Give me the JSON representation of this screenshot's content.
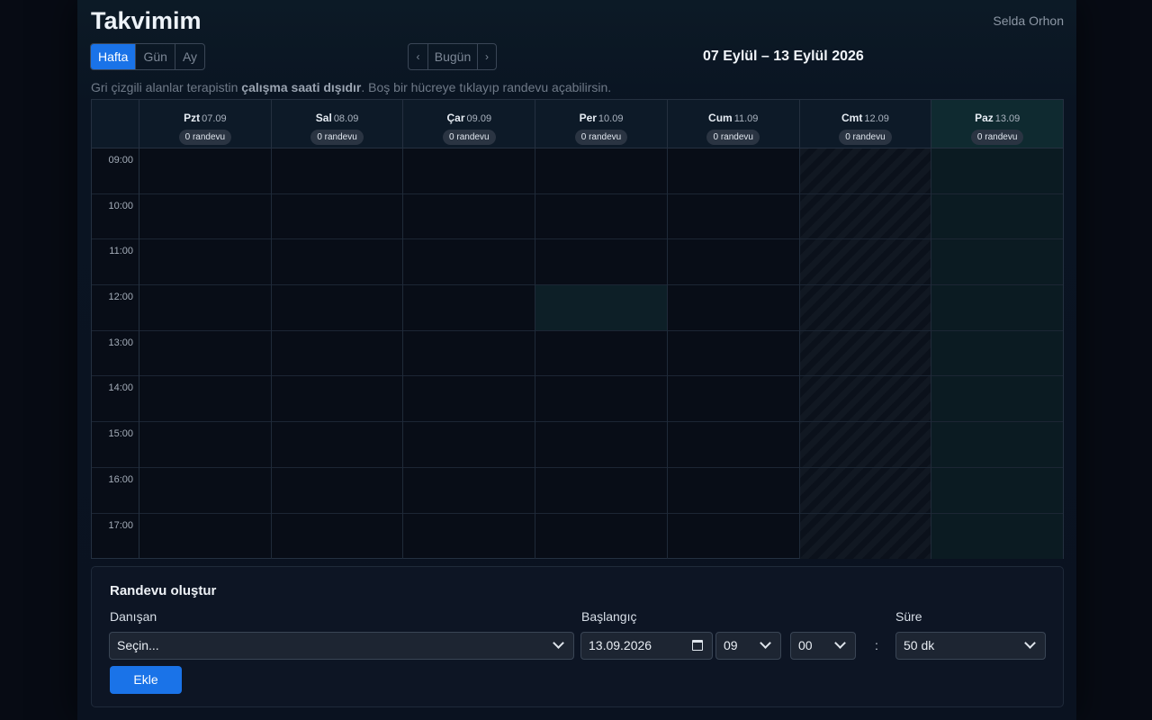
{
  "header": {
    "title": "Takvimim",
    "user_name": "Selda Orhon",
    "views": [
      "Hafta",
      "Gün",
      "Ay"
    ],
    "active_view": "Hafta",
    "nav": {
      "prev": "‹",
      "today": "Bugün",
      "next": "›"
    },
    "range_label": "07 Eylül – 13 Eylül 2026"
  },
  "hint": {
    "before": "Gri çizgili alanlar terapistin ",
    "bold": "çalışma saati dışıdır",
    "after": ". Boş bir hücreye tıklayıp randevu açabilirsin."
  },
  "calendar": {
    "days": [
      {
        "name": "Pzt",
        "date": "07.09",
        "badge": "0 randevu",
        "off": false,
        "today": false
      },
      {
        "name": "Sal",
        "date": "08.09",
        "badge": "0 randevu",
        "off": false,
        "today": false
      },
      {
        "name": "Çar",
        "date": "09.09",
        "badge": "0 randevu",
        "off": false,
        "today": false
      },
      {
        "name": "Per",
        "date": "10.09",
        "badge": "0 randevu",
        "off": false,
        "today": false
      },
      {
        "name": "Cum",
        "date": "11.09",
        "badge": "0 randevu",
        "off": false,
        "today": false
      },
      {
        "name": "Cmt",
        "date": "12.09",
        "badge": "0 randevu",
        "off": true,
        "today": false
      },
      {
        "name": "Paz",
        "date": "13.09",
        "badge": "0 randevu",
        "off": false,
        "today": true
      }
    ],
    "times": [
      "09:00",
      "10:00",
      "11:00",
      "12:00",
      "13:00",
      "14:00",
      "15:00",
      "16:00",
      "17:00"
    ],
    "highlight": {
      "day_index": 3,
      "time_index": 3
    }
  },
  "form": {
    "title": "Randevu oluştur",
    "client_label": "Danışan",
    "client_value": "Seçin...",
    "start_label": "Başlangıç",
    "date_value": "13.09.2026",
    "hour_value": "09",
    "minute_value": "00",
    "colon": ":",
    "duration_label": "Süre",
    "duration_value": "50 dk",
    "submit_label": "Ekle"
  },
  "colors": {
    "accent": "#1a73e8",
    "background": "#070b14",
    "today_column": "#0b1b22"
  }
}
